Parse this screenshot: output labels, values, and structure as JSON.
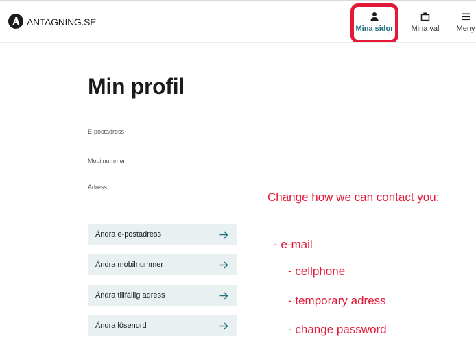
{
  "header": {
    "logo_text": "ANTAGNING.SE",
    "nav": {
      "mina_sidor": "Mina sidor",
      "mina_val": "Mina val",
      "meny": "Meny"
    }
  },
  "main": {
    "title": "Min profil",
    "fields": [
      {
        "label": "E-postadress",
        "value": ""
      },
      {
        "label": "Mobilnummer",
        "value": ""
      },
      {
        "label": "Adress",
        "value": ""
      }
    ],
    "actions": [
      {
        "label": "Ändra e-postadress"
      },
      {
        "label": "Ändra mobilnummer"
      },
      {
        "label": "Ändra tillfällig adress"
      },
      {
        "label": "Ändra lösenord"
      }
    ]
  },
  "annotation": {
    "title": "Change how we can contact you:",
    "items": [
      "- e-mail",
      "- cellphone",
      "- temporary adress",
      "- change password"
    ]
  },
  "colors": {
    "accent": "#1f6f7f",
    "button_bg": "#e9f0f1",
    "annotation": "#e31937"
  },
  "icons": [
    "logo-icon",
    "person-icon",
    "briefcase-icon",
    "menu-icon",
    "arrow-right-icon"
  ]
}
